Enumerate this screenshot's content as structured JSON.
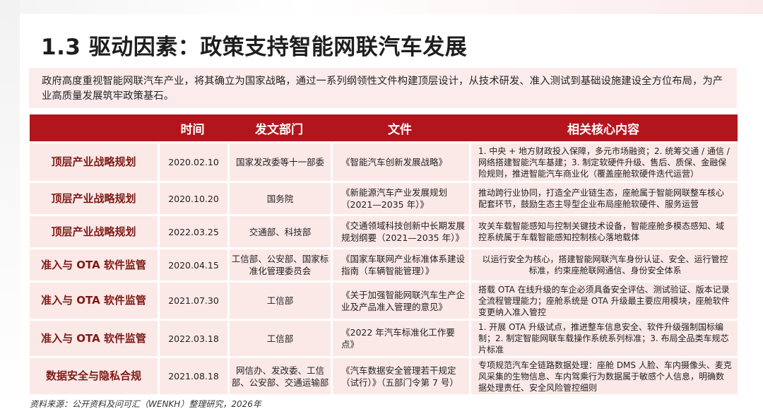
{
  "title": "1.3 驱动因素：政策支持智能网联汽车发展",
  "intro": "政府高度重视智能网联汽车产业，将其确立为国家战略，通过一系列纲领性文件构建顶层设计，从技术研发、准入测试到基础设施建设全方位布局，为产业高质量发展筑牢政策基石。",
  "table": {
    "headers": [
      "",
      "时间",
      "发文部门",
      "文件",
      "相关核心内容"
    ],
    "rows": [
      {
        "category": "顶层产业战略规划",
        "date": "2020.02.10",
        "dept": "国家发改委等十一部委",
        "doc": "《智能汽车创新发展战略》",
        "content": "1. 中央 + 地方财政投入保障，多元市场融资；2. 统筹交通 / 通信 / 网络搭建智能汽车基建；3. 制定软硬件升级、售后、质保、金融保险规则，推进智能汽车商业化（覆盖座舱软硬件迭代运营）"
      },
      {
        "category": "顶层产业战略规划",
        "date": "2020.10.20",
        "dept": "国务院",
        "doc": "《新能源汽车产业发展规划（2021—2035 年）》",
        "content": "推动跨行业协同，打造全产业链生态，座舱属于智能网联整车核心配套环节，鼓励生态主导型企业布局座舱软硬件、服务运营"
      },
      {
        "category": "顶层产业战略规划",
        "date": "2022.03.25",
        "dept": "交通部、科技部",
        "doc": "《交通领域科技创新中长期发展规划纲要（2021—2035 年）》",
        "content": "攻关车载智能感知与控制关键技术设备，智能座舱多模态感知、域控系统属于车载智能感知控制核心落地载体"
      },
      {
        "category": "准入与 OTA 软件监管",
        "date": "2020.04.15",
        "dept": "工信部、公安部、国家标准化管理委员会",
        "doc": "《国家车联网产业标准体系建设指南（车辆智能管理）》",
        "content": "以运行安全为核心，搭建智能网联汽车身份认证、安全、运行管控标准，约束座舱联网通信、身份安全体系"
      },
      {
        "category": "准入与 OTA 软件监管",
        "date": "2021.07.30",
        "dept": "工信部",
        "doc": "《关于加强智能网联汽车生产企业及产品准入管理的意见》",
        "content": "搭载 OTA 在线升级的车企必须具备安全评估、测试验证、版本记录全流程管理能力；座舱系统是 OTA 升级最主要应用模块，座舱软件变更纳入准入管控"
      },
      {
        "category": "准入与 OTA 软件监管",
        "date": "2022.03.18",
        "dept": "工信部",
        "doc": "《2022 年汽车标准化工作要点》",
        "content": "1. 开展 OTA 升级试点，推进整车信息安全、软件升级强制国标编制；2. 制定智能网联车载操作系统系列标准；3. 布局全品类车规芯片标准"
      },
      {
        "category": "数据安全与隐私合规",
        "date": "2021.08.18",
        "dept": "网信办、发改委、工信部、公安部、交通运输部",
        "doc": "《汽车数据安全管理若干规定（试行）》（五部门令第 7 号）",
        "content": "专项规范汽车全链路数据处理：座舱 DMS 人脸、车内摄像头、麦克风采集的生物信息、车内驾乘行为数据属于敏感个人信息，明确数据处理责任、安全风险管控细则"
      }
    ]
  },
  "source": "资料来源：公开资料及问可汇（WENKH）整理研究，2026年"
}
